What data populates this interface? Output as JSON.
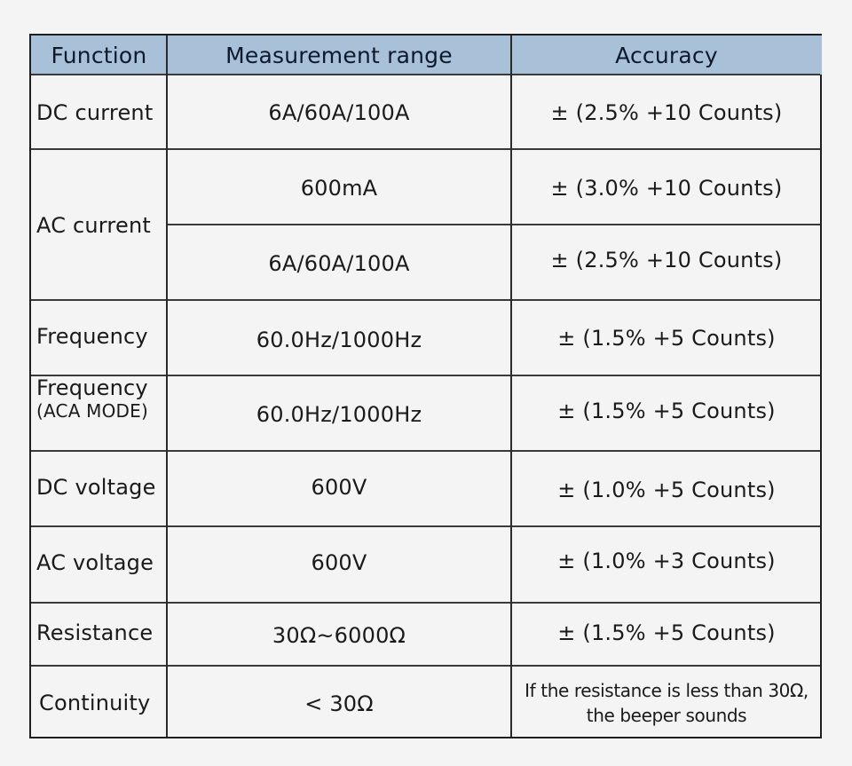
{
  "table": {
    "headers": [
      "Function",
      "Measurement range",
      "Accuracy"
    ],
    "rows": [
      {
        "function": "DC current",
        "range": "6A/60A/100A",
        "accuracy": "± (2.5% +10  Counts)"
      },
      {
        "function": "AC current",
        "range": "600mA",
        "accuracy": "± (3.0% +10 Counts)"
      },
      {
        "function": "AC current",
        "range": "6A/60A/100A",
        "accuracy": "± (2.5%  +10 Counts)"
      },
      {
        "function": "Frequency",
        "range": "60.0Hz/1000Hz",
        "accuracy": "± (1.5%  +5 Counts)"
      },
      {
        "function": "Frequency",
        "function_sub": "(ACA MODE)",
        "range": "60.0Hz/1000Hz",
        "accuracy": "± (1.5%  +5 Counts)"
      },
      {
        "function": "DC voltage",
        "range": "600V",
        "accuracy": "± (1.0%  +5 Counts)"
      },
      {
        "function": "AC voltage",
        "range": "600V",
        "accuracy": "± (1.0%  +3 Counts)"
      },
      {
        "function": "Resistance",
        "range": "30Ω~6000Ω",
        "accuracy": "± (1.5%  +5 Counts)"
      },
      {
        "function": "Continuity",
        "range": "< 30Ω",
        "accuracy_line1": "If the resistance is less than 30Ω,",
        "accuracy_line2": "the beeper sounds"
      }
    ]
  },
  "colors": {
    "header_bg": "#a9c1d8",
    "page_bg": "#f4f4f5",
    "border": "#1f1f1f"
  }
}
